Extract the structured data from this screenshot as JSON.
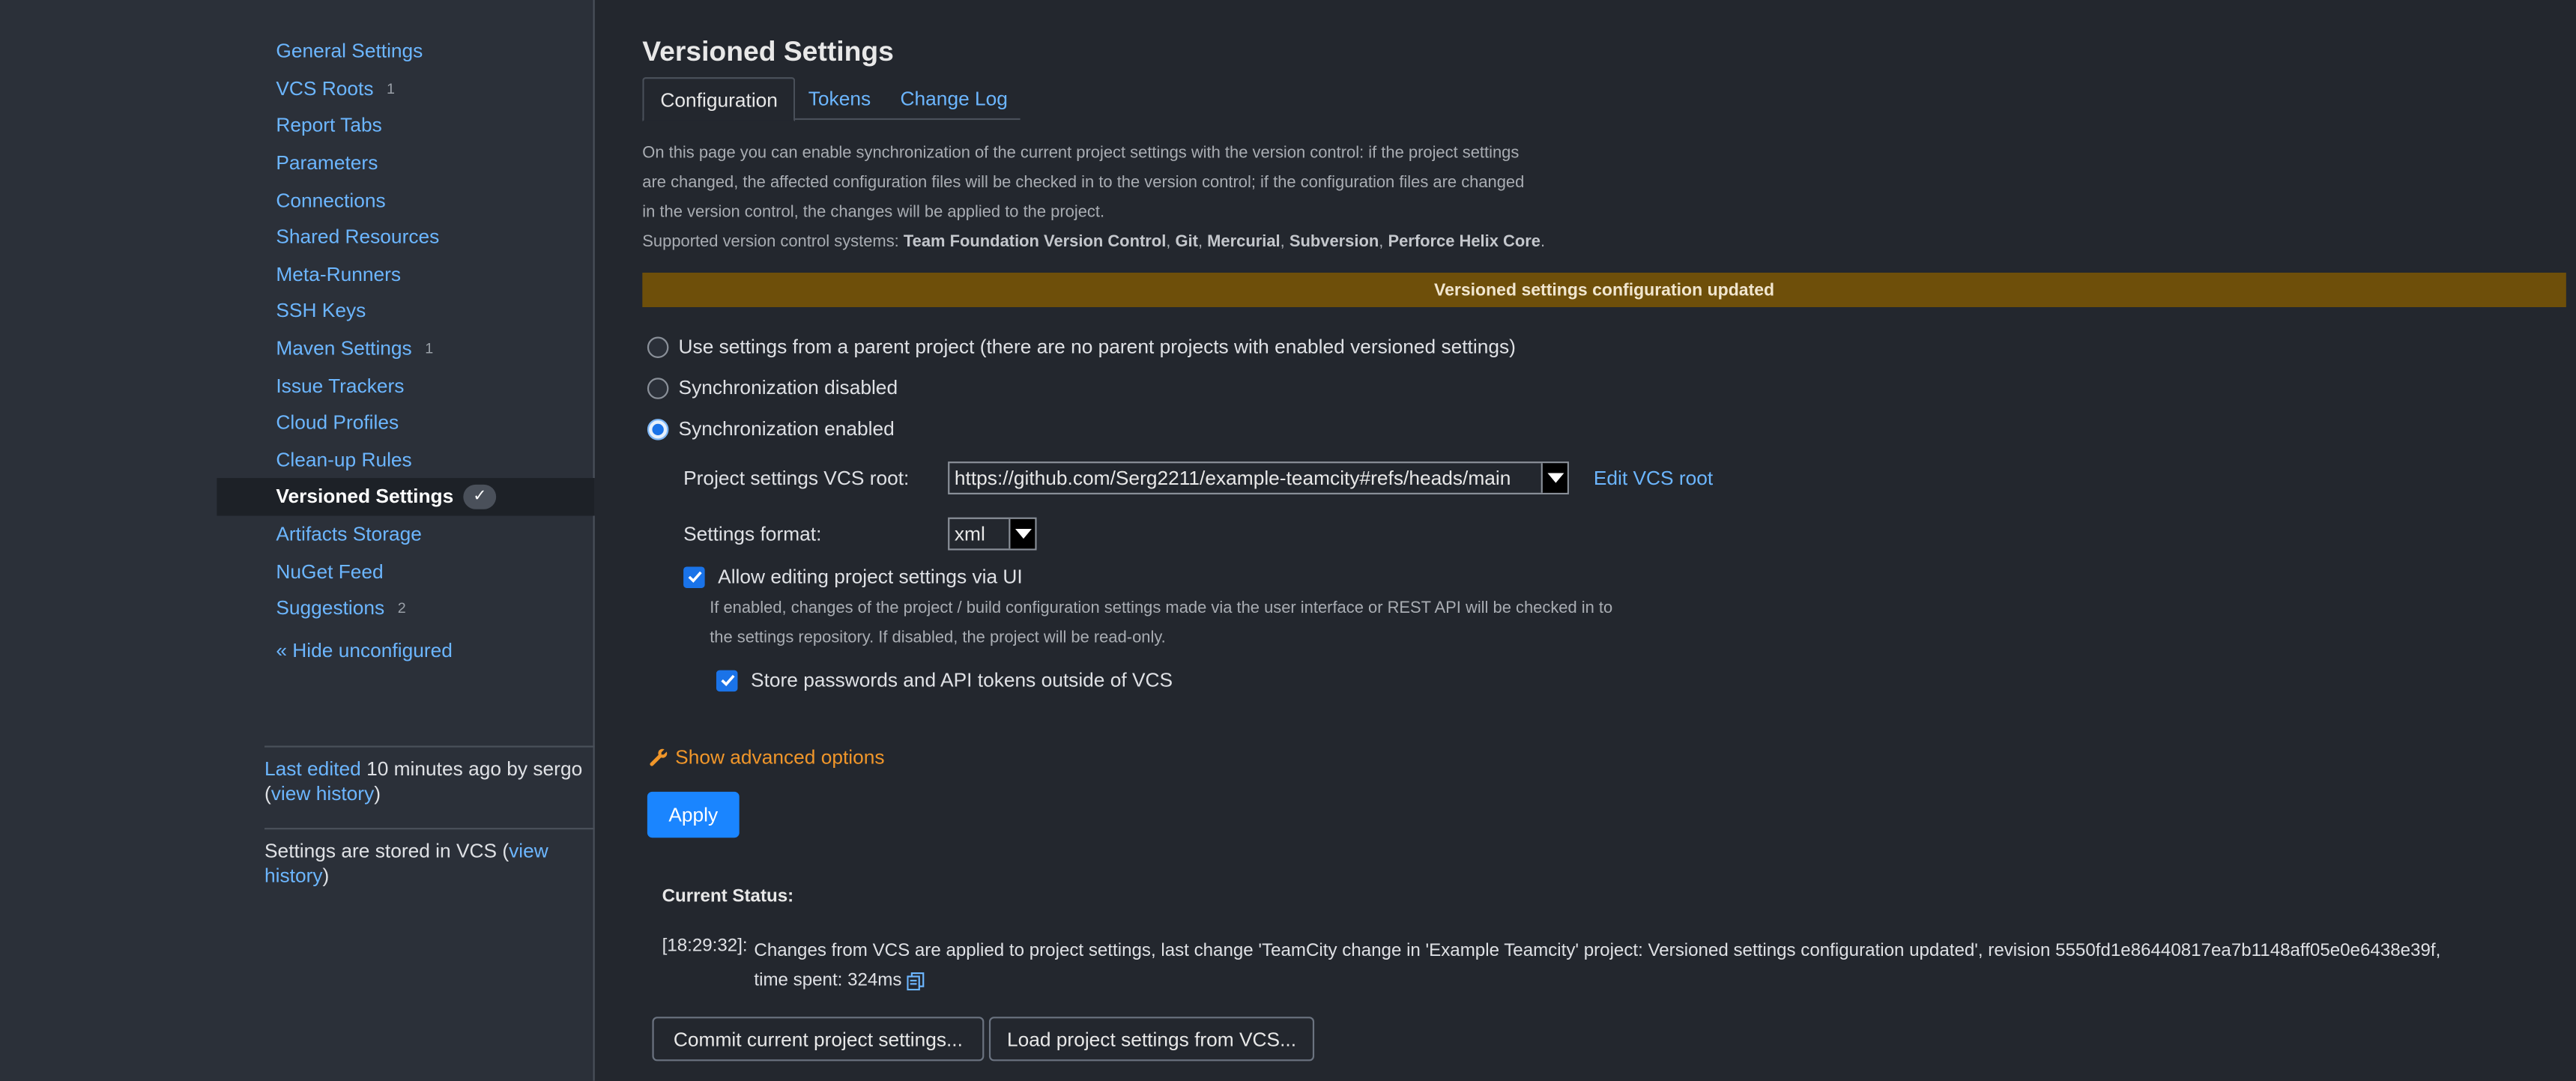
{
  "sidebar": {
    "items": [
      {
        "label": "General Settings",
        "count": ""
      },
      {
        "label": "VCS Roots",
        "count": "1"
      },
      {
        "label": "Report Tabs",
        "count": ""
      },
      {
        "label": "Parameters",
        "count": ""
      },
      {
        "label": "Connections",
        "count": ""
      },
      {
        "label": "Shared Resources",
        "count": ""
      },
      {
        "label": "Meta-Runners",
        "count": ""
      },
      {
        "label": "SSH Keys",
        "count": ""
      },
      {
        "label": "Maven Settings",
        "count": "1"
      },
      {
        "label": "Issue Trackers",
        "count": ""
      },
      {
        "label": "Cloud Profiles",
        "count": ""
      },
      {
        "label": "Clean-up Rules",
        "count": ""
      },
      {
        "label": "Versioned Settings",
        "count": "",
        "badge": "✓"
      },
      {
        "label": "Artifacts Storage",
        "count": ""
      },
      {
        "label": "NuGet Feed",
        "count": ""
      },
      {
        "label": "Suggestions",
        "count": "2"
      }
    ],
    "hide_unconfigured": "« Hide unconfigured",
    "last_edited_link": "Last edited",
    "last_edited_text": " 10 minutes ago by sergo",
    "view_history": "view history",
    "stored_text": "Settings are stored in VCS (",
    "stored_link_1": "view",
    "stored_link_2": "history"
  },
  "page": {
    "title": "Versioned Settings",
    "tabs": [
      "Configuration",
      "Tokens",
      "Change Log"
    ],
    "desc_line1": "On this page you can enable synchronization of the current project settings with the version control: if the project settings",
    "desc_line2": "are changed, the affected configuration files will be checked in to the version control; if the configuration files are changed",
    "desc_line3": "in the version control, the changes will be applied to the project.",
    "desc_supported": "Supported version control systems: ",
    "vcs_systems": [
      "Team Foundation Version Control",
      "Git",
      "Mercurial",
      "Subversion",
      "Perforce Helix Core"
    ],
    "banner": "Versioned settings configuration updated",
    "radio_parent": "Use settings from a parent project (there are no parent projects with enabled versioned settings)",
    "radio_disabled": "Synchronization disabled",
    "radio_enabled": "Synchronization enabled",
    "vcs_root_label": "Project settings VCS root:",
    "vcs_root_value": "https://github.com/Serg2211/example-teamcity#refs/heads/main",
    "edit_vcs_root": "Edit VCS root",
    "format_label": "Settings format:",
    "format_value": "xml",
    "allow_editing": "Allow editing project settings via UI",
    "help_line1": "If enabled, changes of the project / build configuration settings made via the user interface or REST API will be checked in to",
    "help_line2": "the settings repository. If disabled, the project will be read-only.",
    "store_passwords": "Store passwords and API tokens outside of VCS",
    "show_advanced": "Show advanced options",
    "apply": "Apply",
    "status_title": "Current Status:",
    "status_time": "[18:29:32]:",
    "status_line1": "Changes from VCS are applied to project settings, last change 'TeamCity change in 'Example Teamcity' project: Versioned settings configuration updated', revision 5550fd1e86440817ea7b1148aff05e0e6438e39f,",
    "status_line2": "time spent: 324ms",
    "commit_btn": "Commit current project settings...",
    "load_btn": "Load project settings from VCS..."
  },
  "colors": {
    "background": "#23272e",
    "sidebar": "#2b3039",
    "link": "#6cb6ff",
    "banner": "#6e4f0a",
    "primary": "#1a85ff",
    "advanced": "#f0962a"
  }
}
